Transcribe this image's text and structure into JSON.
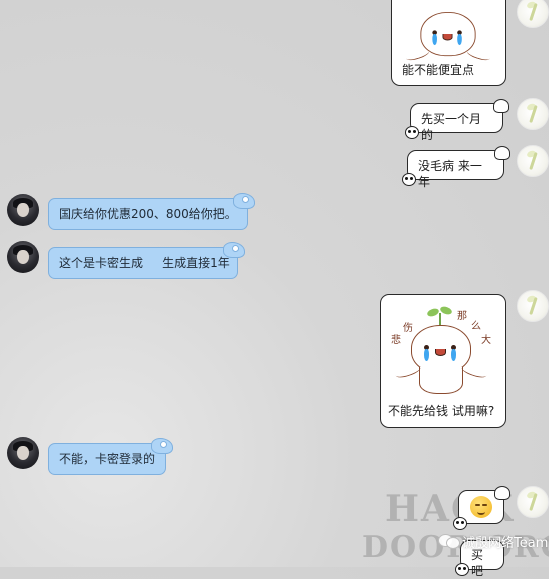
{
  "messages": [
    {
      "id": "m1",
      "side": "right",
      "type": "sticker",
      "text": "能不能便宜点"
    },
    {
      "id": "m2",
      "side": "right",
      "type": "text",
      "text": "先买一个月的"
    },
    {
      "id": "m3",
      "side": "right",
      "type": "text",
      "text": "没毛病 来一年"
    },
    {
      "id": "m4",
      "side": "left",
      "type": "text",
      "text": "国庆给你优惠200、800给你把。"
    },
    {
      "id": "m5",
      "side": "left",
      "type": "text",
      "text": "这个是卡密生成     生成直接1年"
    },
    {
      "id": "m6",
      "side": "right",
      "type": "sticker",
      "text": "不能先给钱 试用嘛?",
      "sticker_chars": [
        "悲",
        "伤",
        "那",
        "么",
        "大"
      ]
    },
    {
      "id": "m7",
      "side": "left",
      "type": "text",
      "text": "不能，卡密登录的"
    },
    {
      "id": "m8",
      "side": "right",
      "type": "emoji",
      "text": "买吧"
    }
  ],
  "watermark": {
    "line1": "HACK",
    "line2": "DOOR.ORG",
    "caption": "诚殷网络Team"
  },
  "icons": {
    "right_avatar": "sprout-avatar-icon",
    "left_avatar": "dark-anime-avatar-icon",
    "bubble_decor": "panda-icon",
    "watermark_logo": "wechat-logo-icon"
  },
  "colors": {
    "left_bubble": "#aed4f6",
    "left_bubble_border": "#7fb0de",
    "right_bubble": "#ffffff",
    "right_bubble_border": "#2a2a2a"
  }
}
